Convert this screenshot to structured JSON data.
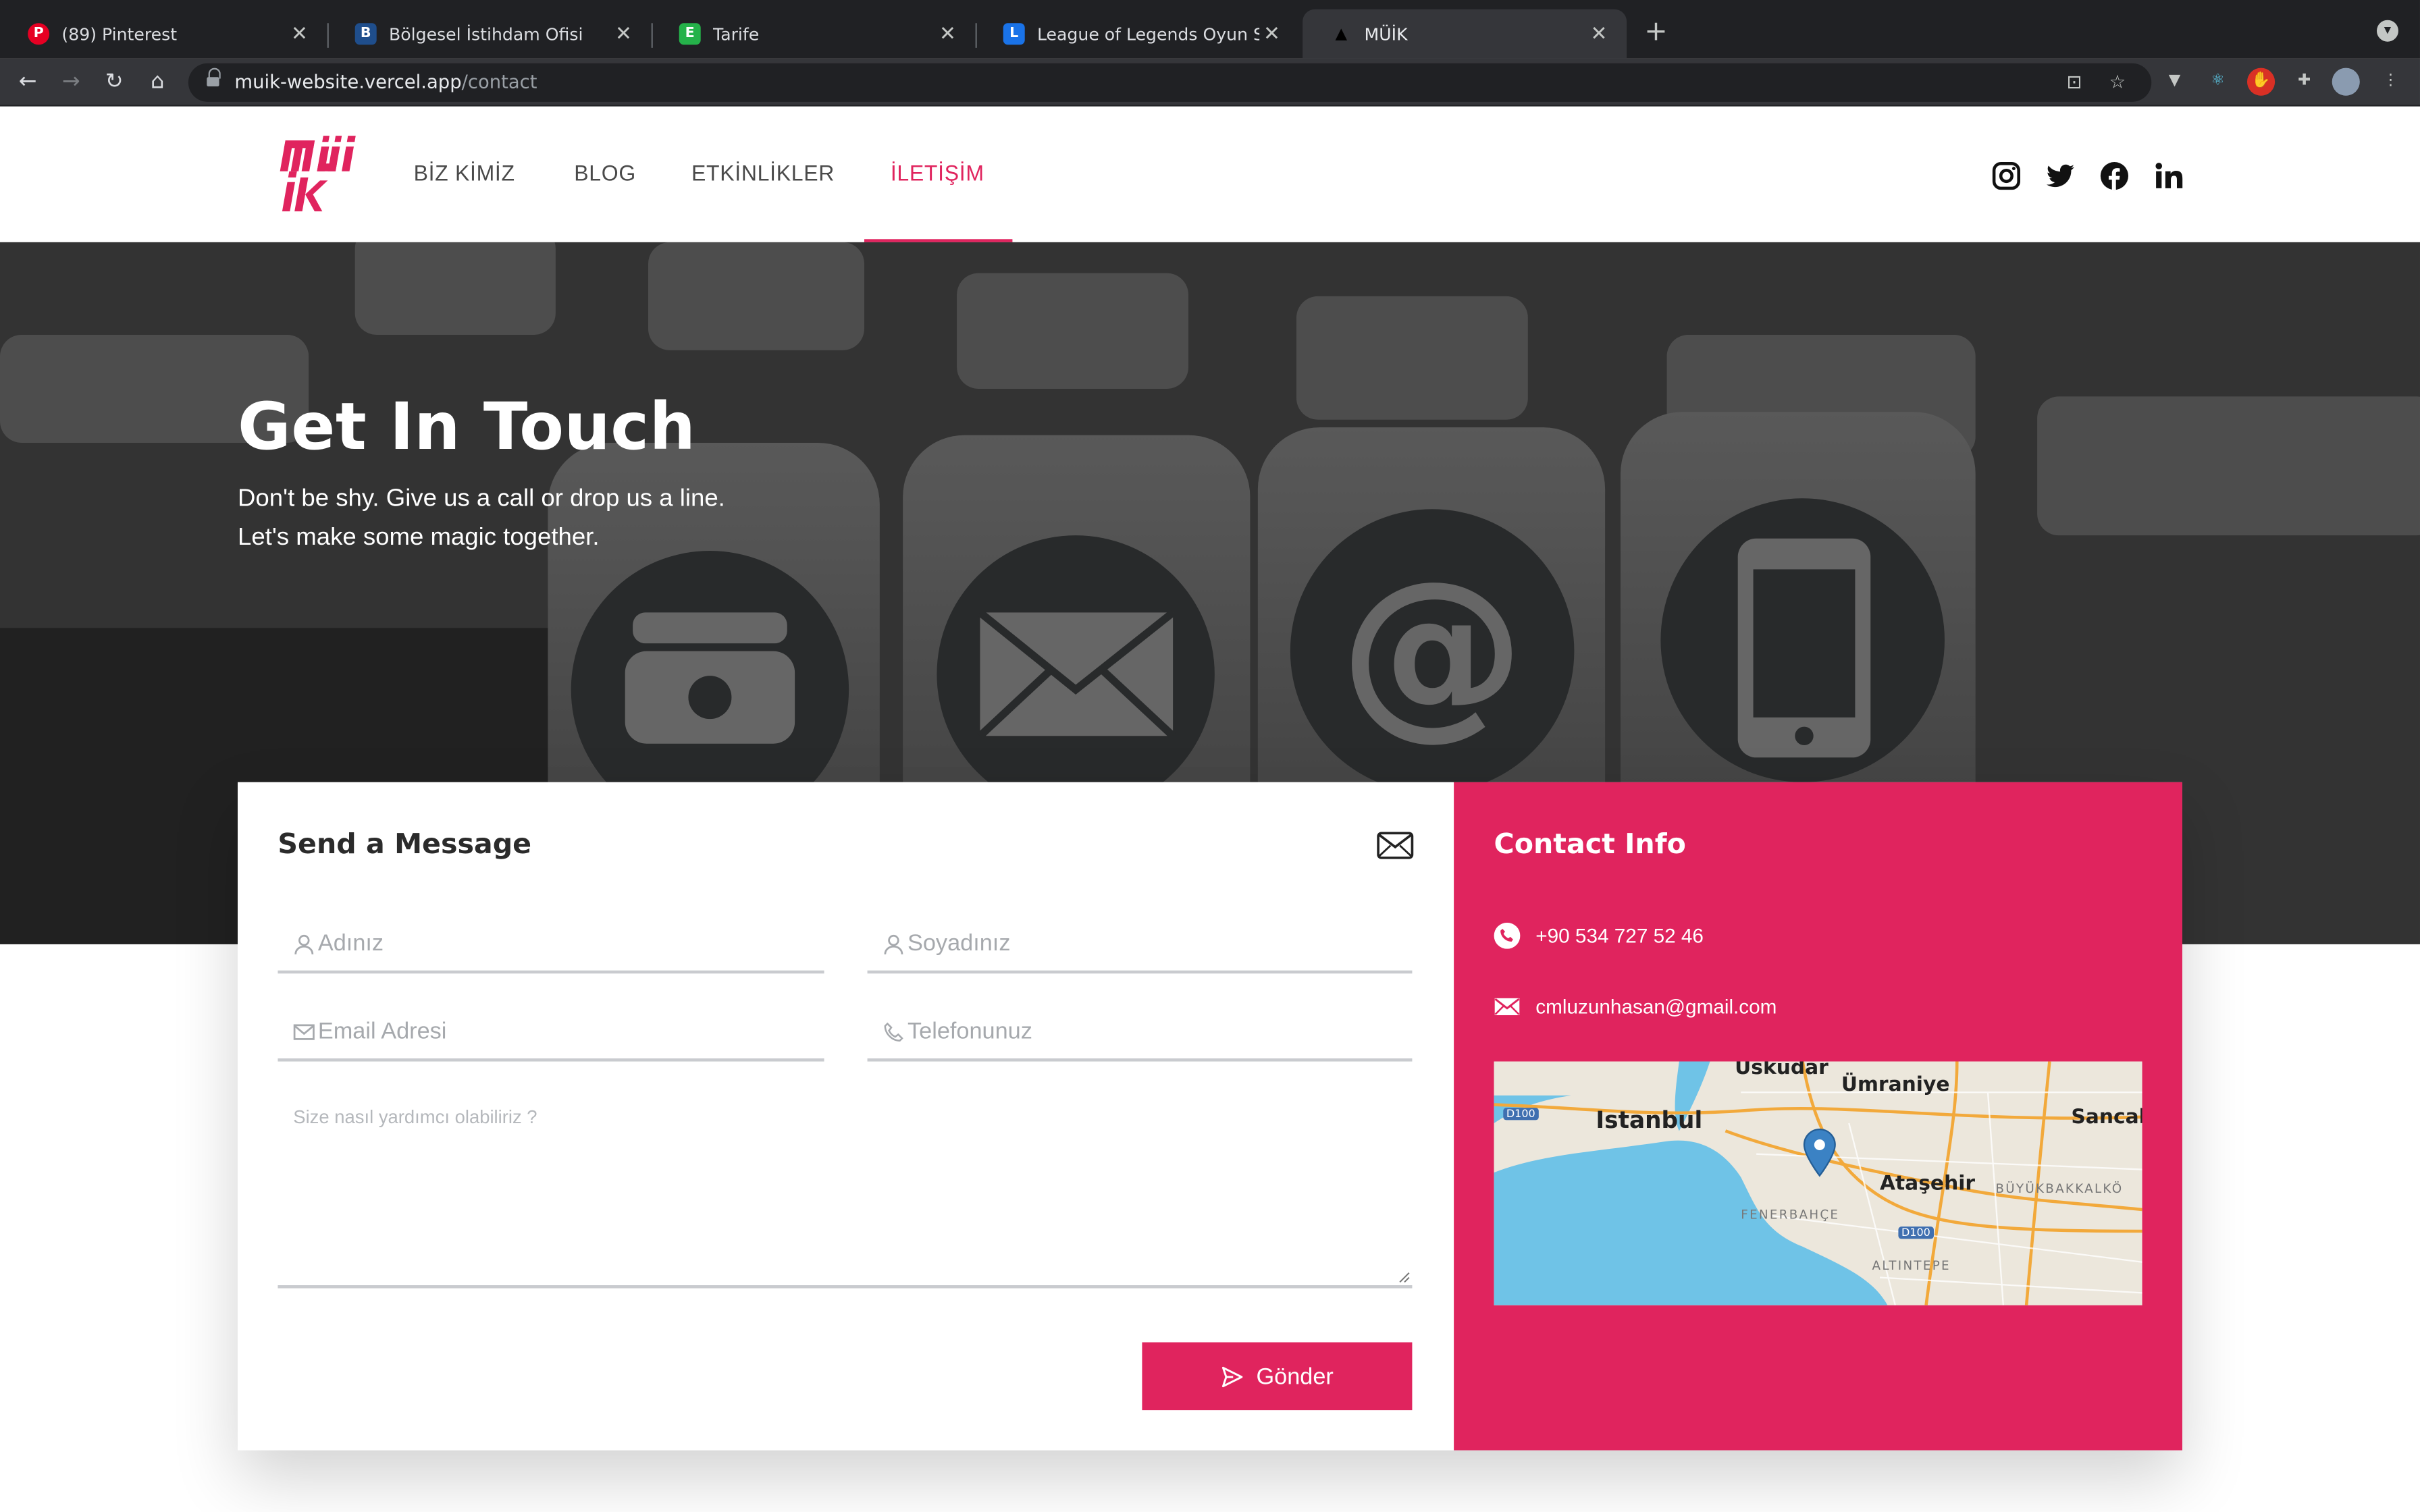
{
  "browser": {
    "tabs": [
      {
        "title": "(89) Pinterest",
        "favicon": "P",
        "favicon_color": "#e60023"
      },
      {
        "title": "Bölgesel İstihdam Ofisi",
        "favicon": "B",
        "favicon_color": "#1f4e8c"
      },
      {
        "title": "Tarife",
        "favicon": "E",
        "favicon_color": "#25b24a"
      },
      {
        "title": "League of Legends Oyun Sonra",
        "favicon": "L",
        "favicon_color": "#1a73e8"
      },
      {
        "title": "MÜİK",
        "favicon": "▲",
        "favicon_color": "#000000"
      }
    ],
    "active_tab": 4,
    "url_host": "muik-website.vercel.app",
    "url_path": "/contact"
  },
  "site": {
    "brand_color": "#e0245e",
    "nav": [
      {
        "label": "BİZ KİMİZ"
      },
      {
        "label": "BLOG"
      },
      {
        "label": "ETKİNLİKLER"
      },
      {
        "label": "İLETİŞİM"
      }
    ],
    "active_nav": 3,
    "socials": [
      "instagram-icon",
      "twitter-icon",
      "facebook-icon",
      "linkedin-icon"
    ]
  },
  "hero": {
    "title": "Get In Touch",
    "line1": "Don't be shy. Give us a call or drop us a line.",
    "line2": "Let's make some magic together."
  },
  "form": {
    "title": "Send a Message",
    "first_name_placeholder": "Adınız",
    "last_name_placeholder": "Soyadınız",
    "email_placeholder": "Email Adresi",
    "phone_placeholder": "Telefonunuz",
    "message_placeholder": "Size nasıl yardımcı olabiliriz ?",
    "submit_label": "Gönder"
  },
  "contact": {
    "title": "Contact Info",
    "phone": "+90 534 727 52 46",
    "email": "cmluzunhasan@gmail.com",
    "map": {
      "labels": [
        "Üsküdar",
        "Ümraniye",
        "Istanbul",
        "Sancak",
        "Ataşehir",
        "BÜYÜKBAKKALKÖ",
        "FENERBAHÇE",
        "ALTINTEPE"
      ],
      "roads": [
        "D100",
        "D100"
      ]
    }
  }
}
